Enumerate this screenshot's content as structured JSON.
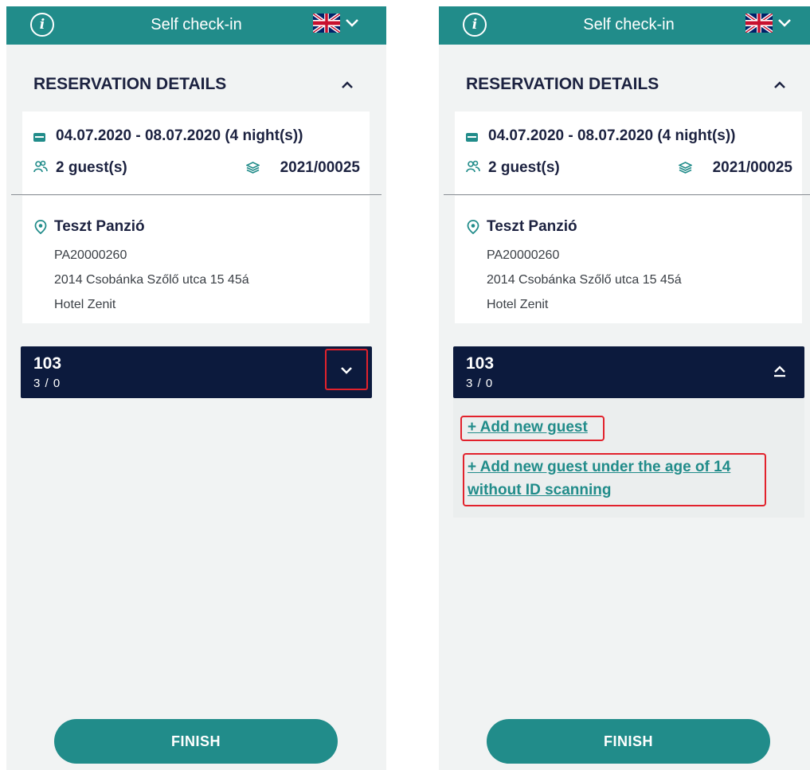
{
  "screens": [
    {
      "header": {
        "title": "Self check-in",
        "info_icon": "info-icon",
        "flag_icon": "uk-flag-icon",
        "language_chevron": "chevron-down-icon"
      },
      "reservation": {
        "section_title": "RESERVATION DETAILS",
        "dates": "04.07.2020 - 08.07.2020 (4 night(s))",
        "guests": "2 guest(s)",
        "reservation_number": "2021/00025"
      },
      "property": {
        "name": "Teszt Panzió",
        "lines": [
          "PA20000260",
          "2014 Csobánka Szőlő utca 15 45á",
          "Hotel Zenit"
        ]
      },
      "room": {
        "number": "103",
        "occupancy": "3 / 0",
        "expanded": false
      },
      "finish_label": "FINISH"
    },
    {
      "header": {
        "title": "Self check-in",
        "info_icon": "info-icon",
        "flag_icon": "uk-flag-icon",
        "language_chevron": "chevron-down-icon"
      },
      "reservation": {
        "section_title": "RESERVATION DETAILS",
        "dates": "04.07.2020 - 08.07.2020 (4 night(s))",
        "guests": "2 guest(s)",
        "reservation_number": "2021/00025"
      },
      "property": {
        "name": "Teszt Panzió",
        "lines": [
          "PA20000260",
          "2014 Csobánka Szőlő utca 15 45á",
          "Hotel Zenit"
        ]
      },
      "room": {
        "number": "103",
        "occupancy": "3 / 0",
        "expanded": true,
        "add_guest_label": "+ Add new guest",
        "add_child_label": "+ Add new guest under the age of 14 without ID scanning"
      },
      "finish_label": "FINISH"
    }
  ],
  "colors": {
    "teal": "#218c8a",
    "navy": "#0c1a3d",
    "highlight_red": "#e2222c",
    "background": "#f1f3f3"
  }
}
